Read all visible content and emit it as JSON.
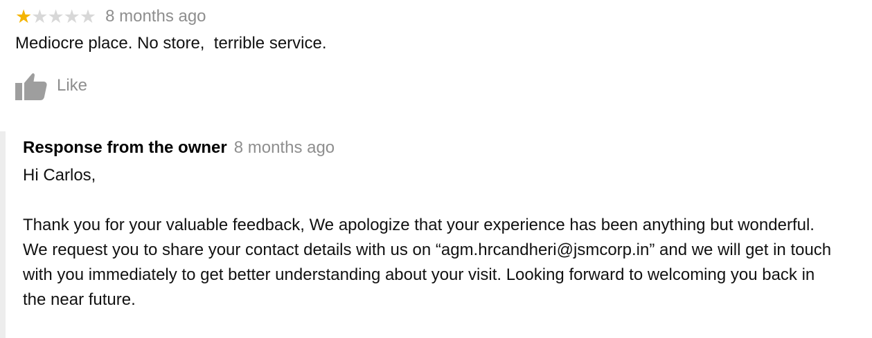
{
  "review": {
    "rating": 1,
    "max_rating": 5,
    "star_icon": "star-icon",
    "star_on_color": "#f4b400",
    "star_off_color": "#d8d8d8",
    "date": "8 months ago",
    "text": "Mediocre place. No store,  terrible service."
  },
  "like": {
    "icon": "thumbs-up-icon",
    "label": "Like"
  },
  "owner_response": {
    "title": "Response from the owner",
    "date": "8 months ago",
    "greeting": "Hi Carlos,",
    "paragraph": "Thank you for your valuable feedback, We apologize that your experience has been anything but wonderful. We request you to share your contact details with us on “agm.hrcandheri@jsmcorp.in” and we will get in touch with you immediately to get better understanding about your visit. Looking forward to welcoming you back in the near future."
  }
}
